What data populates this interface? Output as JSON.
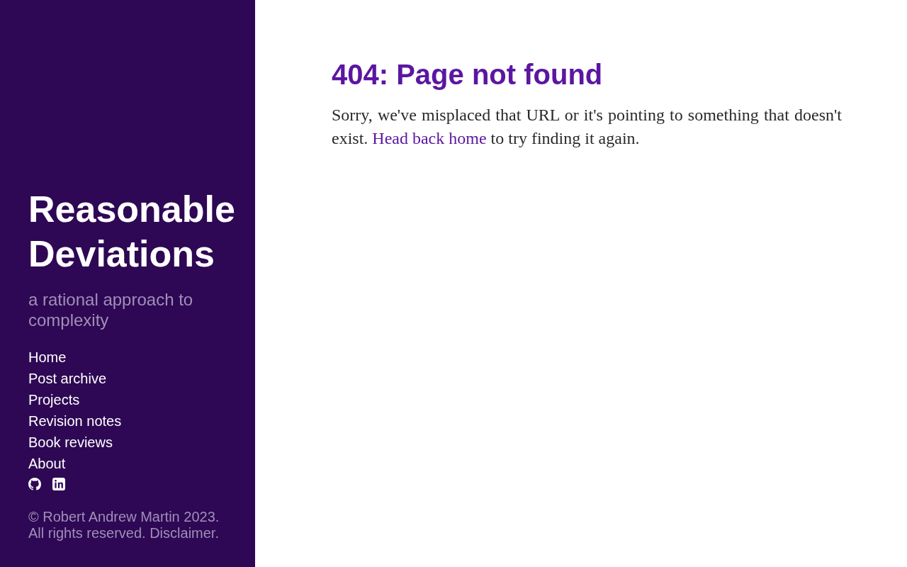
{
  "sidebar": {
    "title": "Reasonable Deviations",
    "tagline": "a rational approach to complexity",
    "nav": [
      {
        "label": "Home"
      },
      {
        "label": "Post archive"
      },
      {
        "label": "Projects"
      },
      {
        "label": "Revision notes"
      },
      {
        "label": "Book reviews"
      },
      {
        "label": "About"
      }
    ],
    "social": [
      {
        "kind": "github"
      },
      {
        "kind": "linkedin"
      }
    ],
    "footer": "© Robert Andrew Martin 2023. All rights reserved. Disclaimer."
  },
  "main": {
    "heading": "404: Page not found",
    "text_before": "Sorry, we've misplaced that URL or it's pointing to something that doesn't exist.",
    "link": "Head back home",
    "text_after": "to try finding it again."
  }
}
